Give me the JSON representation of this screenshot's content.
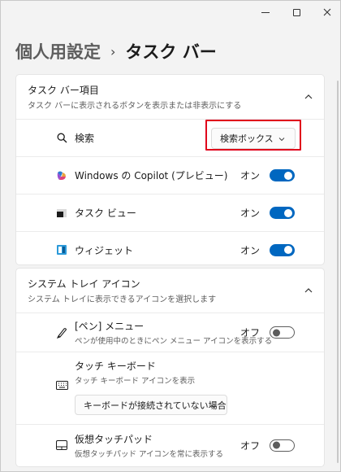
{
  "header": {
    "parent": "個人用設定",
    "separator": "›",
    "current": "タスク バー"
  },
  "taskbar_items": {
    "title": "タスク バー項目",
    "subtitle": "タスク バーに表示されるボタンを表示または非表示にする",
    "search": {
      "label": "検索",
      "dropdown_value": "検索ボックス"
    },
    "copilot": {
      "label": "Windows の Copilot (プレビュー)",
      "state": "オン"
    },
    "taskview": {
      "label": "タスク ビュー",
      "state": "オン"
    },
    "widgets": {
      "label": "ウィジェット",
      "state": "オン"
    }
  },
  "system_tray": {
    "title": "システム トレイ アイコン",
    "subtitle": "システム トレイに表示できるアイコンを選択します",
    "pen": {
      "label": "[ペン] メニュー",
      "sub": "ペンが使用中のときにペン メニュー アイコンを表示する",
      "state": "オフ"
    },
    "touch_keyboard": {
      "label": "タッチ キーボード",
      "sub": "タッチ キーボード アイコンを表示",
      "dropdown_value": "キーボードが接続されていない場合"
    },
    "touchpad": {
      "label": "仮想タッチパッド",
      "sub": "仮想タッチパッド アイコンを常に表示する",
      "state": "オフ"
    }
  },
  "colors": {
    "accent": "#0067c0",
    "highlight": "#e0001b"
  }
}
